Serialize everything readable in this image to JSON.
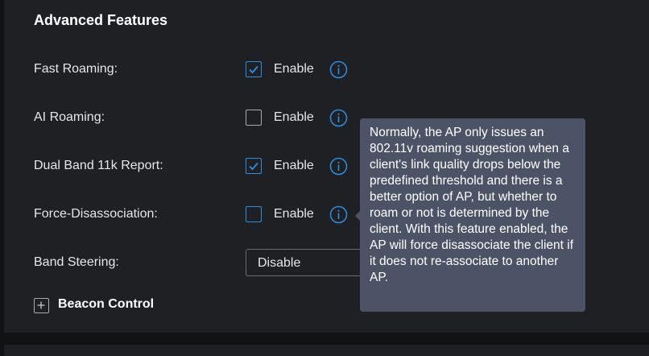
{
  "section": {
    "title": "Advanced Features"
  },
  "rows": [
    {
      "label": "Fast Roaming",
      "colon": ":",
      "checked": true,
      "enable_label": "Enable",
      "info_icon": "info-icon"
    },
    {
      "label": "AI Roaming",
      "colon": ":",
      "checked": false,
      "enable_label": "Enable",
      "info_icon": "info-icon"
    },
    {
      "label": "Dual Band 11k Report",
      "colon": ":",
      "checked": true,
      "enable_label": "Enable",
      "info_icon": "info-icon"
    },
    {
      "label": "Force-Disassociation",
      "colon": ":",
      "checked": false,
      "enable_label": "Enable",
      "info_icon": "info-icon"
    }
  ],
  "band_steering": {
    "label": "Band Steering",
    "colon": ":",
    "selected": "Disable"
  },
  "beacon_control": {
    "label": "Beacon Control",
    "icon": "plus-square-icon"
  },
  "tooltip": {
    "text": "Normally, the AP only issues an 802.11v roaming suggestion when a client's link quality drops below the predefined threshold and there is a better option of AP, but whether to roam or not is determined by the client. With this feature enabled, the AP will force disassociate the client if it does not re-associate to another AP."
  },
  "colors": {
    "accent": "#2b8fe3",
    "background": "#1f2024",
    "tooltip_bg": "#4c5366"
  }
}
